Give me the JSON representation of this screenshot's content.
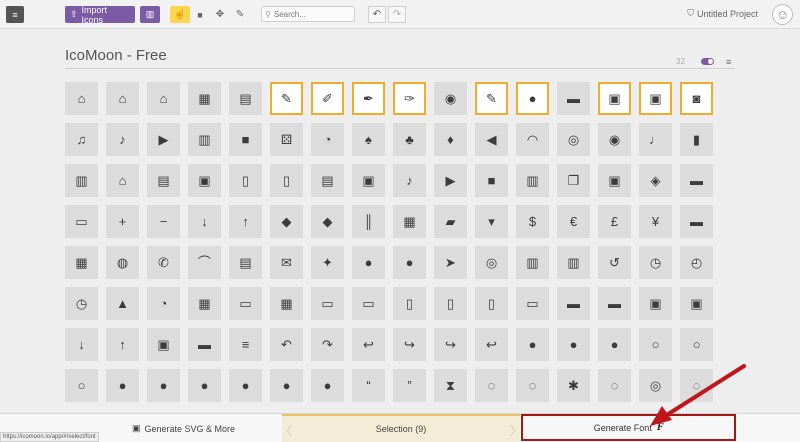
{
  "toolbar": {
    "import_label": "Import Icons",
    "search_placeholder": "Search...",
    "project_name": "Untitled Project"
  },
  "set": {
    "title": "IcoMoon - Free",
    "count": "32"
  },
  "icons": [
    {
      "name": "home-icon",
      "glyph": "⌂"
    },
    {
      "name": "home2-icon",
      "glyph": "⌂"
    },
    {
      "name": "home3-icon",
      "glyph": "⌂"
    },
    {
      "name": "office-icon",
      "glyph": "▦"
    },
    {
      "name": "newspaper-icon",
      "glyph": "▤"
    },
    {
      "name": "pencil-icon",
      "glyph": "✎",
      "selected": true
    },
    {
      "name": "pencil2-icon",
      "glyph": "✐",
      "selected": true
    },
    {
      "name": "quill-icon",
      "glyph": "✒",
      "selected": true
    },
    {
      "name": "pen-icon",
      "glyph": "✑",
      "selected": true
    },
    {
      "name": "blog-icon",
      "glyph": "◉"
    },
    {
      "name": "eyedropper-icon",
      "glyph": "✎",
      "selected": true
    },
    {
      "name": "droplet-icon",
      "glyph": "●",
      "selected": true
    },
    {
      "name": "paint-format-icon",
      "glyph": "▬"
    },
    {
      "name": "image-icon",
      "glyph": "▣",
      "selected": true
    },
    {
      "name": "images-icon",
      "glyph": "▣",
      "selected": true
    },
    {
      "name": "camera-icon",
      "glyph": "◙",
      "selected": true
    },
    {
      "name": "headphones-icon",
      "glyph": "♫"
    },
    {
      "name": "music-icon",
      "glyph": "♪"
    },
    {
      "name": "play-icon",
      "glyph": "▶"
    },
    {
      "name": "film-icon",
      "glyph": "▥"
    },
    {
      "name": "video-camera-icon",
      "glyph": "■"
    },
    {
      "name": "dice-icon",
      "glyph": "⚄"
    },
    {
      "name": "pacman-icon",
      "glyph": "◔"
    },
    {
      "name": "spades-icon",
      "glyph": "♠"
    },
    {
      "name": "clubs-icon",
      "glyph": "♣"
    },
    {
      "name": "diamonds-icon",
      "glyph": "♦"
    },
    {
      "name": "bullhorn-icon",
      "glyph": "◀"
    },
    {
      "name": "connection-icon",
      "glyph": "◠"
    },
    {
      "name": "podcast-icon",
      "glyph": "◎"
    },
    {
      "name": "feed-icon",
      "glyph": "◉"
    },
    {
      "name": "mic-icon",
      "glyph": "♩"
    },
    {
      "name": "book-icon",
      "glyph": "▮"
    },
    {
      "name": "books-icon",
      "glyph": "▥"
    },
    {
      "name": "library-icon",
      "glyph": "⌂"
    },
    {
      "name": "file-text-icon",
      "glyph": "▤"
    },
    {
      "name": "profile-icon",
      "glyph": "▣"
    },
    {
      "name": "file-empty-icon",
      "glyph": "▯"
    },
    {
      "name": "files-empty-icon",
      "glyph": "▯"
    },
    {
      "name": "file-text2-icon",
      "glyph": "▤"
    },
    {
      "name": "file-picture-icon",
      "glyph": "▣"
    },
    {
      "name": "file-music-icon",
      "glyph": "♪"
    },
    {
      "name": "file-play-icon",
      "glyph": "▶"
    },
    {
      "name": "file-video-icon",
      "glyph": "■"
    },
    {
      "name": "file-zip-icon",
      "glyph": "▥"
    },
    {
      "name": "copy-icon",
      "glyph": "❐"
    },
    {
      "name": "paste-icon",
      "glyph": "▣"
    },
    {
      "name": "stack-icon",
      "glyph": "◈"
    },
    {
      "name": "folder-icon",
      "glyph": "▬"
    },
    {
      "name": "folder-open-icon",
      "glyph": "▭"
    },
    {
      "name": "folder-plus-icon",
      "glyph": "+"
    },
    {
      "name": "folder-minus-icon",
      "glyph": "−"
    },
    {
      "name": "folder-download-icon",
      "glyph": "↓"
    },
    {
      "name": "folder-upload-icon",
      "glyph": "↑"
    },
    {
      "name": "price-tag-icon",
      "glyph": "◆"
    },
    {
      "name": "price-tags-icon",
      "glyph": "◆"
    },
    {
      "name": "barcode-icon",
      "glyph": "║"
    },
    {
      "name": "qrcode-icon",
      "glyph": "▦"
    },
    {
      "name": "ticket-icon",
      "glyph": "▰"
    },
    {
      "name": "cart-icon",
      "glyph": "▾"
    },
    {
      "name": "coin-dollar-icon",
      "glyph": "$"
    },
    {
      "name": "coin-euro-icon",
      "glyph": "€"
    },
    {
      "name": "coin-pound-icon",
      "glyph": "£"
    },
    {
      "name": "coin-yen-icon",
      "glyph": "¥"
    },
    {
      "name": "credit-card-icon",
      "glyph": "▬"
    },
    {
      "name": "calculator-icon",
      "glyph": "▦"
    },
    {
      "name": "lifebuoy-icon",
      "glyph": "◍"
    },
    {
      "name": "phone-icon",
      "glyph": "✆"
    },
    {
      "name": "phone-hang-up-icon",
      "glyph": "⌒"
    },
    {
      "name": "address-book-icon",
      "glyph": "▤"
    },
    {
      "name": "envelop-icon",
      "glyph": "✉"
    },
    {
      "name": "pushpin-icon",
      "glyph": "✦"
    },
    {
      "name": "location-icon",
      "glyph": "●"
    },
    {
      "name": "location2-icon",
      "glyph": "●"
    },
    {
      "name": "compass-icon",
      "glyph": "➤"
    },
    {
      "name": "compass2-icon",
      "glyph": "◎"
    },
    {
      "name": "map-icon",
      "glyph": "▥"
    },
    {
      "name": "map2-icon",
      "glyph": "▥"
    },
    {
      "name": "history-icon",
      "glyph": "↺"
    },
    {
      "name": "clock-icon",
      "glyph": "◷"
    },
    {
      "name": "clock2-icon",
      "glyph": "◴"
    },
    {
      "name": "alarm-icon",
      "glyph": "◷"
    },
    {
      "name": "bell-icon",
      "glyph": "▲"
    },
    {
      "name": "stopwatch-icon",
      "glyph": "◔"
    },
    {
      "name": "calendar-icon",
      "glyph": "▦"
    },
    {
      "name": "printer-icon",
      "glyph": "▭"
    },
    {
      "name": "keyboard-icon",
      "glyph": "▦"
    },
    {
      "name": "display-icon",
      "glyph": "▭"
    },
    {
      "name": "laptop-icon",
      "glyph": "▭"
    },
    {
      "name": "mobile-icon",
      "glyph": "▯"
    },
    {
      "name": "mobile2-icon",
      "glyph": "▯"
    },
    {
      "name": "tablet-icon",
      "glyph": "▯"
    },
    {
      "name": "tv-icon",
      "glyph": "▭"
    },
    {
      "name": "drawer-icon",
      "glyph": "▬"
    },
    {
      "name": "drawer2-icon",
      "glyph": "▬"
    },
    {
      "name": "box-add-icon",
      "glyph": "▣"
    },
    {
      "name": "box-remove-icon",
      "glyph": "▣"
    },
    {
      "name": "download-icon",
      "glyph": "↓"
    },
    {
      "name": "upload-icon",
      "glyph": "↑"
    },
    {
      "name": "floppy-disk-icon",
      "glyph": "▣"
    },
    {
      "name": "drive-icon",
      "glyph": "▬"
    },
    {
      "name": "database-icon",
      "glyph": "≡"
    },
    {
      "name": "undo-icon",
      "glyph": "↶"
    },
    {
      "name": "redo-icon",
      "glyph": "↷"
    },
    {
      "name": "undo2-icon",
      "glyph": "↩"
    },
    {
      "name": "redo2-icon",
      "glyph": "↪"
    },
    {
      "name": "forward-icon",
      "glyph": "↪"
    },
    {
      "name": "reply-icon",
      "glyph": "↩"
    },
    {
      "name": "bubble-icon",
      "glyph": "●"
    },
    {
      "name": "bubbles-icon",
      "glyph": "●"
    },
    {
      "name": "bubbles2-icon",
      "glyph": "●"
    },
    {
      "name": "bubble2-icon",
      "glyph": "○"
    },
    {
      "name": "bubbles3-icon",
      "glyph": "○"
    },
    {
      "name": "bubbles4-icon",
      "glyph": "○"
    },
    {
      "name": "user-icon",
      "glyph": "●"
    },
    {
      "name": "users-icon",
      "glyph": "●"
    },
    {
      "name": "user-plus-icon",
      "glyph": "●"
    },
    {
      "name": "user-minus-icon",
      "glyph": "●"
    },
    {
      "name": "user-check-icon",
      "glyph": "●"
    },
    {
      "name": "user-tie-icon",
      "glyph": "●"
    },
    {
      "name": "quotes-left-icon",
      "glyph": "“"
    },
    {
      "name": "quotes-right-icon",
      "glyph": "”"
    },
    {
      "name": "hour-glass-icon",
      "glyph": "⧗"
    },
    {
      "name": "spinner-icon",
      "glyph": "◌"
    },
    {
      "name": "spinner2-icon",
      "glyph": "◌"
    },
    {
      "name": "spinner3-icon",
      "glyph": "✱"
    },
    {
      "name": "spinner4-icon",
      "glyph": "◌"
    },
    {
      "name": "spinner5-icon",
      "glyph": "◎"
    },
    {
      "name": "spinner6-icon",
      "glyph": "◌"
    }
  ],
  "footer": {
    "url": "https://icomoon.io/app/#/select/font",
    "generate_svg_label": "Generate SVG & More",
    "selection_label": "Selection (9)",
    "generate_font_label": "Generate Font"
  },
  "colors": {
    "accent": "#7b5aa6",
    "selected_border": "#f0ad2a",
    "annotation": "#c0171a"
  }
}
